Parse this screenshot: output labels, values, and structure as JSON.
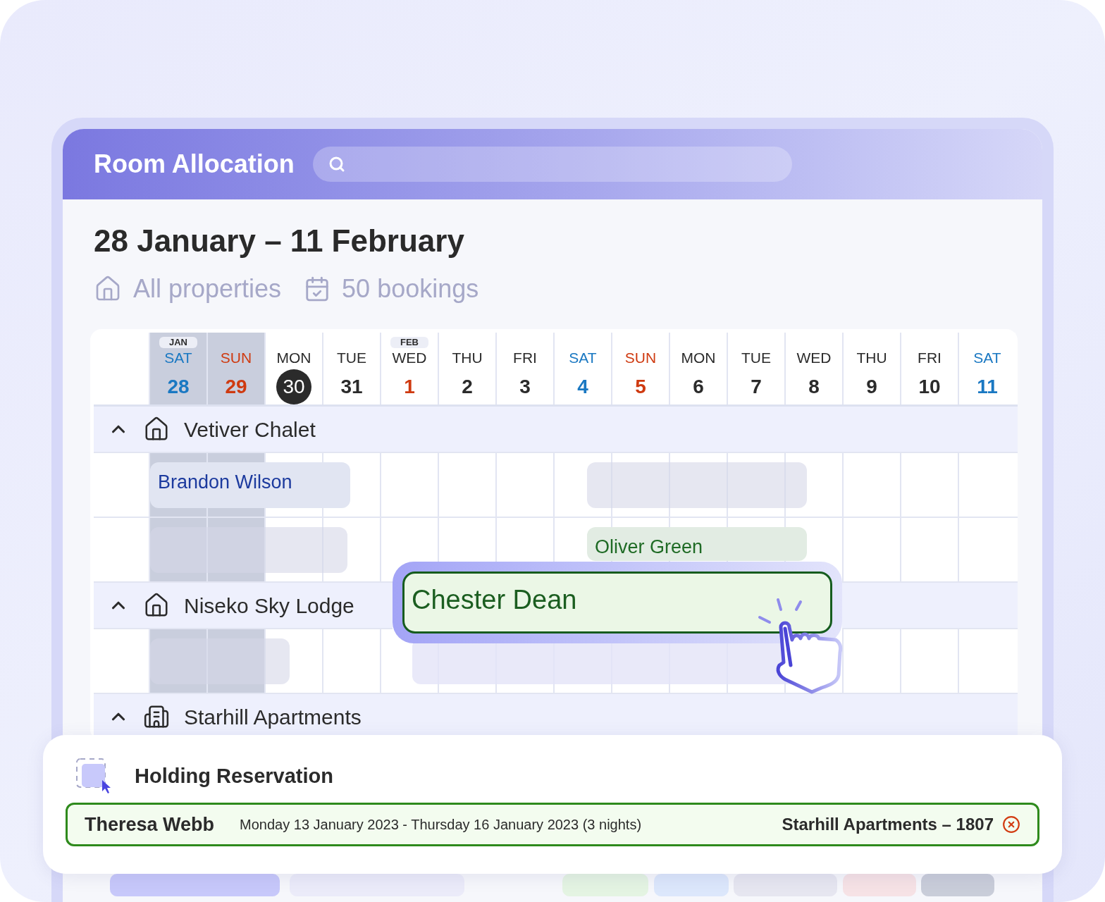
{
  "header": {
    "title": "Room Allocation"
  },
  "date_range": "28 January – 11 February",
  "filters": [
    {
      "kind": "properties",
      "label": "All properties"
    },
    {
      "kind": "bookings",
      "label": "50 bookings"
    }
  ],
  "days": [
    {
      "month": "JAN",
      "weekday": "SAT",
      "date": "28",
      "kind": "saturday",
      "shaded": true,
      "today": false
    },
    {
      "weekday": "SUN",
      "date": "29",
      "kind": "sunday",
      "shaded": true,
      "today": false
    },
    {
      "weekday": "MON",
      "date": "30",
      "kind": "weekday",
      "shaded": false,
      "today": true
    },
    {
      "weekday": "TUE",
      "date": "31",
      "kind": "weekday",
      "shaded": false,
      "today": false
    },
    {
      "month": "FEB",
      "weekday": "WED",
      "date": "1",
      "kind": "month_start",
      "shaded": false,
      "today": false
    },
    {
      "weekday": "THU",
      "date": "2",
      "kind": "weekday",
      "shaded": false,
      "today": false
    },
    {
      "weekday": "FRI",
      "date": "3",
      "kind": "weekday",
      "shaded": false,
      "today": false
    },
    {
      "weekday": "SAT",
      "date": "4",
      "kind": "saturday",
      "shaded": false,
      "today": false
    },
    {
      "weekday": "SUN",
      "date": "5",
      "kind": "sunday",
      "shaded": false,
      "today": false
    },
    {
      "weekday": "MON",
      "date": "6",
      "kind": "weekday",
      "shaded": false,
      "today": false
    },
    {
      "weekday": "TUE",
      "date": "7",
      "kind": "weekday",
      "shaded": false,
      "today": false
    },
    {
      "weekday": "WED",
      "date": "8",
      "kind": "weekday",
      "shaded": false,
      "today": false
    },
    {
      "weekday": "THU",
      "date": "9",
      "kind": "weekday",
      "shaded": false,
      "today": false
    },
    {
      "weekday": "FRI",
      "date": "10",
      "kind": "weekday",
      "shaded": false,
      "today": false
    },
    {
      "weekday": "SAT",
      "date": "11",
      "kind": "saturday",
      "shaded": false,
      "today": false
    }
  ],
  "properties": [
    {
      "name": "Vetiver Chalet",
      "kind": "house",
      "expanded": true,
      "rows": [
        {
          "bookings": [
            {
              "kind": "guest",
              "guest": "Brandon Wilson",
              "color": "#1c3a9e"
            },
            {
              "kind": "hold"
            }
          ]
        },
        {
          "bookings": [
            {
              "kind": "hold"
            },
            {
              "kind": "guest",
              "guest": "Oliver Green",
              "color": "#1f6b25"
            }
          ]
        }
      ]
    },
    {
      "name": "Niseko Sky Lodge",
      "kind": "house",
      "expanded": true,
      "rows": [
        {
          "bookings": [
            {
              "kind": "hold"
            },
            {
              "kind": "drop_target"
            }
          ]
        }
      ]
    },
    {
      "name": "Starhill Apartments",
      "kind": "building",
      "expanded": true
    }
  ],
  "dragging": {
    "guest": "Chester Dean"
  },
  "holding": {
    "title": "Holding Reservation",
    "items": [
      {
        "guest": "Theresa Webb",
        "dates": "Monday 13 January 2023 - Thursday 16 January 2023 (3 nights)",
        "property": "Starhill Apartments – 1807"
      }
    ]
  }
}
